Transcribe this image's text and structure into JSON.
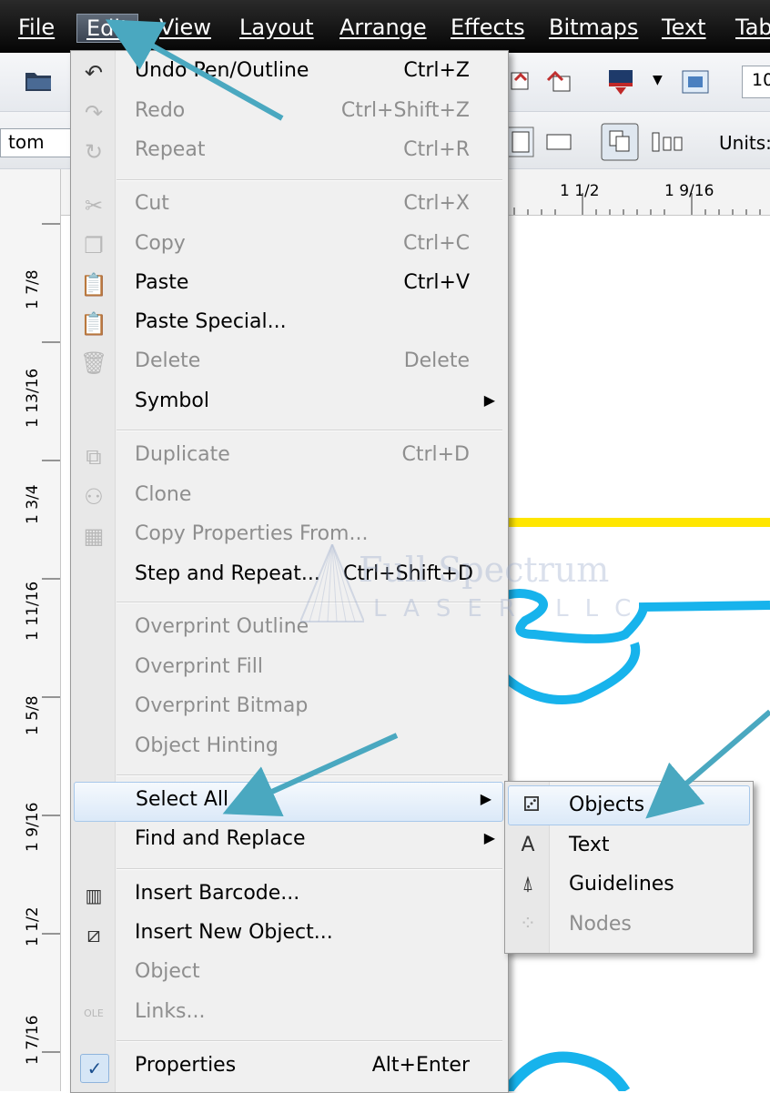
{
  "menubar": {
    "items": [
      "File",
      "Edit",
      "View",
      "Layout",
      "Arrange",
      "Effects",
      "Bitmaps",
      "Text",
      "Tab"
    ]
  },
  "toolbar": {
    "left_fragment": "tom",
    "units_label": "Units:",
    "zoom_fragment": "10"
  },
  "rulers": {
    "top": [
      "1 1/2",
      "1 9/16"
    ],
    "left": [
      "1 7/8",
      "1 13/16",
      "1 3/4",
      "1 11/16",
      "1 5/8",
      "1 9/16",
      "1 1/2",
      "1 7/16"
    ]
  },
  "edit_menu": {
    "items": [
      {
        "label": "Undo Pen/Outline",
        "shortcut": "Ctrl+Z",
        "icon": "undo-icon",
        "enabled": true
      },
      {
        "label": "Redo",
        "shortcut": "Ctrl+Shift+Z",
        "icon": "redo-icon",
        "enabled": false
      },
      {
        "label": "Repeat",
        "shortcut": "Ctrl+R",
        "icon": "repeat-icon",
        "enabled": false
      },
      {
        "label": "Cut",
        "shortcut": "Ctrl+X",
        "icon": "scissors-icon",
        "enabled": false
      },
      {
        "label": "Copy",
        "shortcut": "Ctrl+C",
        "icon": "copy-icon",
        "enabled": false
      },
      {
        "label": "Paste",
        "shortcut": "Ctrl+V",
        "icon": "paste-icon",
        "enabled": true
      },
      {
        "label": "Paste Special...",
        "shortcut": "",
        "icon": "paste-special-icon",
        "enabled": true
      },
      {
        "label": "Delete",
        "shortcut": "Delete",
        "icon": "trash-icon",
        "enabled": false
      },
      {
        "label": "Symbol",
        "shortcut": "",
        "icon": "",
        "enabled": true,
        "submenu": true
      },
      {
        "label": "Duplicate",
        "shortcut": "Ctrl+D",
        "icon": "duplicate-icon",
        "enabled": false
      },
      {
        "label": "Clone",
        "shortcut": "",
        "icon": "clone-icon",
        "enabled": false
      },
      {
        "label": "Copy Properties From...",
        "shortcut": "",
        "icon": "copy-properties-icon",
        "enabled": false
      },
      {
        "label": "Step and Repeat...",
        "shortcut": "Ctrl+Shift+D",
        "icon": "",
        "enabled": true
      },
      {
        "label": "Overprint Outline",
        "shortcut": "",
        "icon": "",
        "enabled": false
      },
      {
        "label": "Overprint Fill",
        "shortcut": "",
        "icon": "",
        "enabled": false
      },
      {
        "label": "Overprint Bitmap",
        "shortcut": "",
        "icon": "",
        "enabled": false
      },
      {
        "label": "Object Hinting",
        "shortcut": "",
        "icon": "",
        "enabled": false
      },
      {
        "label": "Select All",
        "shortcut": "",
        "icon": "",
        "enabled": true,
        "submenu": true,
        "highlighted": true
      },
      {
        "label": "Find and Replace",
        "shortcut": "",
        "icon": "",
        "enabled": true,
        "submenu": true
      },
      {
        "label": "Insert Barcode...",
        "shortcut": "",
        "icon": "barcode-icon",
        "enabled": true
      },
      {
        "label": "Insert New Object...",
        "shortcut": "",
        "icon": "insert-object-icon",
        "enabled": true
      },
      {
        "label": "Object",
        "shortcut": "",
        "icon": "",
        "enabled": false
      },
      {
        "label": "Links...",
        "shortcut": "",
        "icon": "ole-icon",
        "enabled": false
      },
      {
        "label": "Properties",
        "shortcut": "Alt+Enter",
        "icon": "checkmark-icon",
        "enabled": true
      }
    ]
  },
  "select_all_submenu": {
    "items": [
      {
        "label": "Objects",
        "icon": "select-objects-icon",
        "enabled": true,
        "highlighted": true
      },
      {
        "label": "Text",
        "icon": "select-text-icon",
        "enabled": true
      },
      {
        "label": "Guidelines",
        "icon": "select-guidelines-icon",
        "enabled": true
      },
      {
        "label": "Nodes",
        "icon": "select-nodes-icon",
        "enabled": false
      }
    ]
  },
  "watermark": {
    "line1": "Full Spectrum",
    "line2": "LASER LLC"
  },
  "colors": {
    "menubar_bg": "#111111",
    "menu_bg": "#f0f0f0",
    "highlight": "#dbe9f8",
    "arrow": "#4aa8c0",
    "canvas_yellow": "#ffe600",
    "canvas_blue": "#17b3ec"
  }
}
